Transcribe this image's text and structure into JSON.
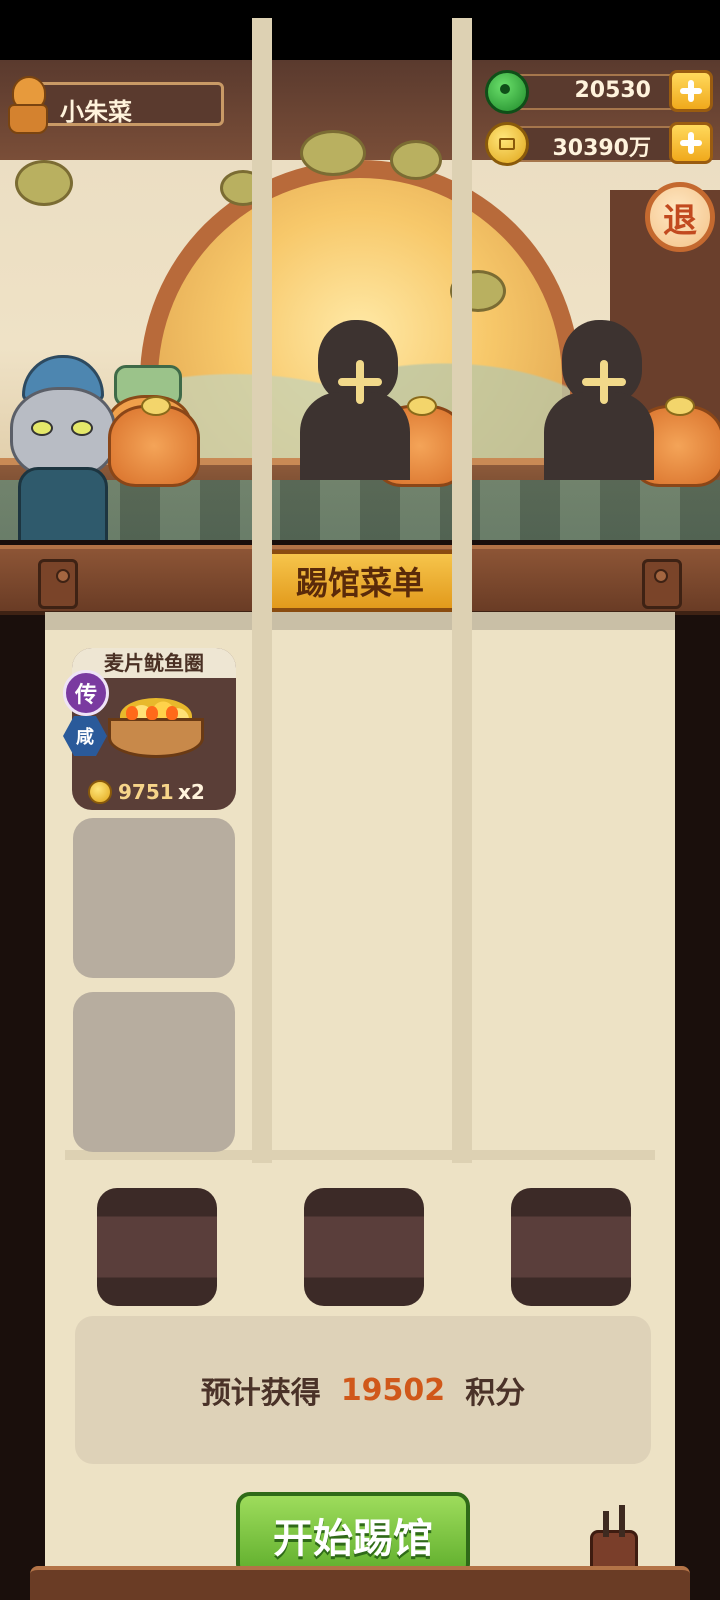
{
  "player": {
    "name": "小朱菜"
  },
  "resources": {
    "gems": {
      "value": "20530",
      "icon": "jade-gem-icon"
    },
    "coins": {
      "value": "30390万",
      "icon": "coin-icon"
    }
  },
  "exit_button": {
    "label": "退"
  },
  "menu": {
    "title": "踢馆菜单",
    "dishes": [
      {
        "name": "麦片鱿鱼圈",
        "rarity_badge": "传",
        "flavor_badge": "咸",
        "price": "9751",
        "quantity": "x2"
      }
    ]
  },
  "estimate": {
    "prefix": "预计获得",
    "points": "19502",
    "suffix": "积分"
  },
  "start_button": {
    "label": "开始踢馆"
  },
  "colors": {
    "accent_green": "#5fae2c",
    "points_orange": "#d0581a",
    "title_gold": "#f6c54c"
  }
}
